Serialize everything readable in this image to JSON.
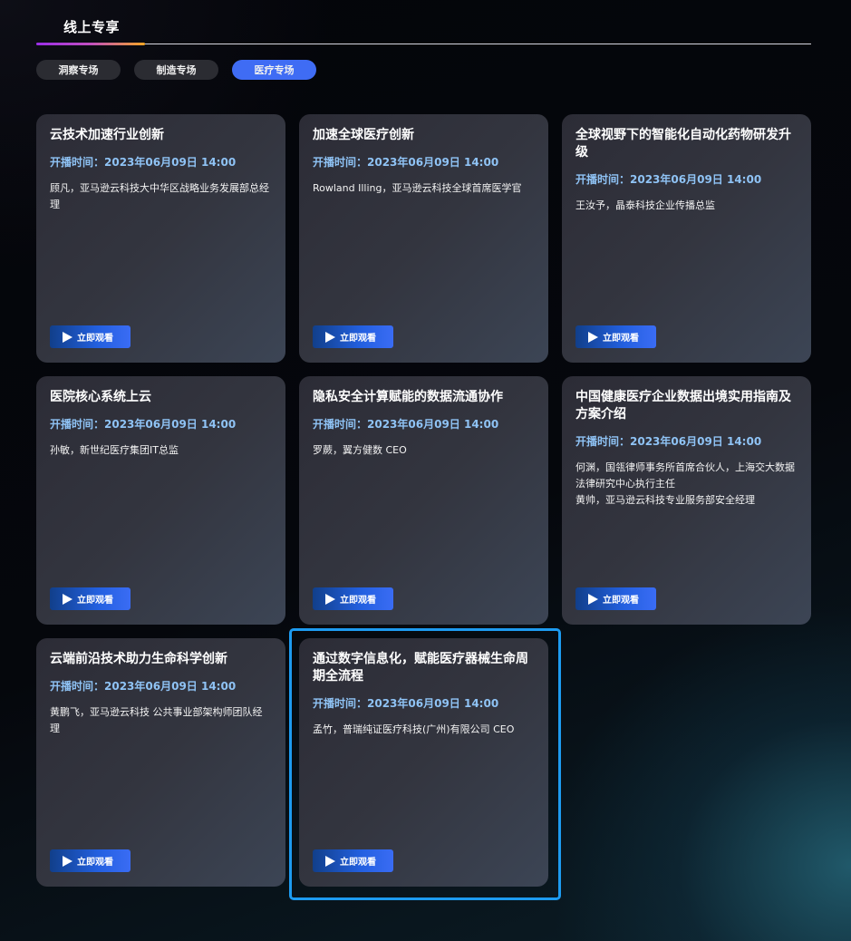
{
  "header": {
    "title": "线上专享"
  },
  "tabs": [
    {
      "label": "洞察专场",
      "active": false
    },
    {
      "label": "制造专场",
      "active": false
    },
    {
      "label": "医疗专场",
      "active": true
    }
  ],
  "colors": {
    "accent": "#3f6cf4",
    "time": "#8fc3f5",
    "selection": "#1d9bf0"
  },
  "cards": [
    {
      "title": "云技术加速行业创新",
      "time": "开播时间：2023年06月09日 14:00",
      "speaker": "顾凡，亚马逊云科技大中华区战略业务发展部总经理",
      "button": "立即观看"
    },
    {
      "title": "加速全球医疗创新",
      "time": "开播时间：2023年06月09日 14:00",
      "speaker": "Rowland Illing，亚马逊云科技全球首席医学官",
      "button": "立即观看"
    },
    {
      "title": "全球视野下的智能化自动化药物研发升级",
      "time": "开播时间：2023年06月09日 14:00",
      "speaker": "王汝予，晶泰科技企业传播总监",
      "button": "立即观看"
    },
    {
      "title": "医院核心系统上云",
      "time": "开播时间：2023年06月09日 14:00",
      "speaker": "孙敏，新世纪医疗集团IT总监",
      "button": "立即观看"
    },
    {
      "title": "隐私安全计算赋能的数据流通协作",
      "time": "开播时间：2023年06月09日 14:00",
      "speaker": "罗蕨，翼方健数 CEO",
      "button": "立即观看"
    },
    {
      "title": "中国健康医疗企业数据出境实用指南及方案介绍",
      "time": "开播时间：2023年06月09日 14:00",
      "speaker": "何渊，国瓴律师事务所首席合伙人，上海交大数据法律研究中心执行主任\n黄帅，亚马逊云科技专业服务部安全经理",
      "button": "立即观看"
    },
    {
      "title": "云端前沿技术助力生命科学创新",
      "time": "开播时间：2023年06月09日 14:00",
      "speaker": "黄鹏飞，亚马逊云科技 公共事业部架构师团队经理",
      "button": "立即观看"
    },
    {
      "title": "通过数字信息化，赋能医疗器械生命周期全流程",
      "time": "开播时间：2023年06月09日 14:00",
      "speaker": "孟竹，普瑞纯证医疗科技(广州)有限公司 CEO",
      "button": "立即观看",
      "selected": true
    }
  ]
}
